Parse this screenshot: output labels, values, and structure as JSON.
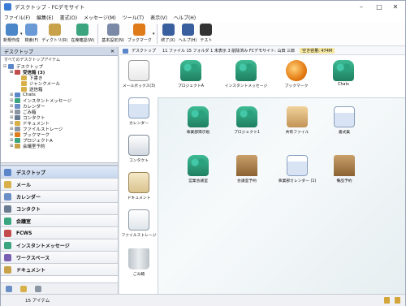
{
  "window": {
    "title": "デスクトップ - FCデモサイト"
  },
  "menu": [
    "ファイル(F)",
    "編集(E)",
    "書式(O)",
    "メッセージ(M)",
    "ツール(T)",
    "表示(V)",
    "ヘルプ(H)"
  ],
  "toolbar": [
    {
      "label": "新規作成",
      "icon": "new-icon",
      "color": "#4a86c8"
    },
    {
      "label": "検索(F)",
      "icon": "search-icon",
      "color": "#6a9ad6"
    },
    {
      "label": "ディクトリ(R)",
      "icon": "directory-icon",
      "color": "#c8a24a"
    },
    {
      "label": "在席確認(W)",
      "icon": "presence-icon",
      "color": "#3aa57f"
    },
    {
      "label": "基本設定(N)",
      "icon": "settings-icon",
      "color": "#7a8aa6"
    },
    {
      "label": "ブックマーク",
      "icon": "bookmark-icon",
      "color": "#e07b1a"
    },
    {
      "label": "終了(X)",
      "icon": "exit-icon",
      "color": "#3a5f9e"
    },
    {
      "label": "ヘルプ(H)",
      "icon": "help-icon",
      "color": "#3a5f9e"
    },
    {
      "label": "テスト",
      "icon": "penguin-icon",
      "color": "#333333"
    }
  ],
  "left": {
    "header": "デスクトップ",
    "subheader": "すべてのデスクトップアイテム",
    "tree": [
      {
        "label": "デスクトップ",
        "level": 0,
        "bold": false,
        "color": "#5b86c9"
      },
      {
        "label": "受信箱 (3)",
        "level": 1,
        "bold": true,
        "color": "#c44b4b"
      },
      {
        "label": "下書き",
        "level": 2,
        "bold": false,
        "color": "#d8b04a"
      },
      {
        "label": "ジャンクメール",
        "level": 2,
        "bold": false,
        "color": "#d8b04a"
      },
      {
        "label": "送信箱",
        "level": 2,
        "bold": false,
        "color": "#d8b04a"
      },
      {
        "label": "Chats",
        "level": 1,
        "bold": false,
        "color": "#5b86c9"
      },
      {
        "label": "インスタントメッセージ",
        "level": 1,
        "bold": false,
        "color": "#3aa57f"
      },
      {
        "label": "カレンダー",
        "level": 1,
        "bold": false,
        "color": "#6a8fc6"
      },
      {
        "label": "ごみ箱",
        "level": 1,
        "bold": false,
        "color": "#8a96a2"
      },
      {
        "label": "コンタクト",
        "level": 1,
        "bold": false,
        "color": "#6a7c92"
      },
      {
        "label": "ドキュメント",
        "level": 1,
        "bold": false,
        "color": "#d8b04a"
      },
      {
        "label": "ファイルストレージ",
        "level": 1,
        "bold": false,
        "color": "#8a96a2"
      },
      {
        "label": "ブックマーク",
        "level": 1,
        "bold": false,
        "color": "#e07b1a"
      },
      {
        "label": "プロジェクトA",
        "level": 1,
        "bold": false,
        "color": "#3aa57f"
      },
      {
        "label": "会議室予約",
        "level": 1,
        "bold": false,
        "color": "#c8a24a"
      }
    ],
    "nav": [
      {
        "label": "デスクトップ",
        "icon": "desktop-icon",
        "color": "#5b86c9",
        "active": true
      },
      {
        "label": "メール",
        "icon": "mail-icon",
        "color": "#d8b04a",
        "active": false
      },
      {
        "label": "カレンダー",
        "icon": "calendar-icon",
        "color": "#6a8fc6",
        "active": false
      },
      {
        "label": "コンタクト",
        "icon": "contact-icon",
        "color": "#6a7c92",
        "active": false
      },
      {
        "label": "会議室",
        "icon": "meeting-room-icon",
        "color": "#3aa57f",
        "active": false
      },
      {
        "label": "FCWS",
        "icon": "fcws-icon",
        "color": "#c44b4b",
        "active": false
      },
      {
        "label": "インスタントメッセージ",
        "icon": "im-icon",
        "color": "#3aa57f",
        "active": false
      },
      {
        "label": "ワークスペース",
        "icon": "workspace-icon",
        "color": "#7a5fb3",
        "active": false
      },
      {
        "label": "ドキュメント",
        "icon": "document-icon",
        "color": "#c8a24a",
        "active": false
      }
    ]
  },
  "path": {
    "label": "デスクトップ",
    "info": "11 ファイル 15 フォルダ 1 未表示 3 削除済み FCデモサイト: 山田 三郎",
    "capacity": "空き容量: 474M"
  },
  "left_strip_items": [
    {
      "label": "メールボックス(3)",
      "icon": "mailbox-icon",
      "kind": "mailicon"
    },
    {
      "label": "カレンダー",
      "icon": "calendar-icon",
      "kind": "calicon"
    },
    {
      "label": "コンタクト",
      "icon": "contacts-icon",
      "kind": "contacts"
    },
    {
      "label": "ドキュメント",
      "icon": "dictionary-icon",
      "kind": "dict"
    },
    {
      "label": "ファイルストレージ",
      "icon": "file-storage-icon",
      "kind": "filestorage"
    },
    {
      "label": "ごみ箱",
      "icon": "trash-icon",
      "kind": "trash"
    }
  ],
  "top_items": [
    {
      "label": "プロジェクトA",
      "icon": "project-icon",
      "kind": "people"
    },
    {
      "label": "インスタントメッセージ",
      "icon": "instant-message-icon",
      "kind": "people"
    },
    {
      "label": "ブックマーク",
      "icon": "bookmark-globe-icon",
      "kind": "globe"
    },
    {
      "label": "Chats",
      "icon": "chats-icon",
      "kind": "people"
    }
  ],
  "canvas_items": [
    {
      "label": "事業部掲示板",
      "icon": "bulletin-icon",
      "kind": "people"
    },
    {
      "label": "プロジェクト1",
      "icon": "project1-icon",
      "kind": "people"
    },
    {
      "label": "共有ファイル",
      "icon": "shared-files-icon",
      "kind": "bag"
    },
    {
      "label": "書式集",
      "icon": "forms-icon",
      "kind": "calicon"
    },
    {
      "label": "営業会議室",
      "icon": "sales-meeting-icon",
      "kind": "people"
    },
    {
      "label": "会議室予約",
      "icon": "room-booking-icon",
      "kind": "door"
    },
    {
      "label": "事業部カレンダー (1)",
      "icon": "division-calendar-icon",
      "kind": "calicon"
    },
    {
      "label": "備品予約",
      "icon": "equipment-booking-icon",
      "kind": "door"
    }
  ],
  "status": {
    "text": "15 アイテム"
  }
}
